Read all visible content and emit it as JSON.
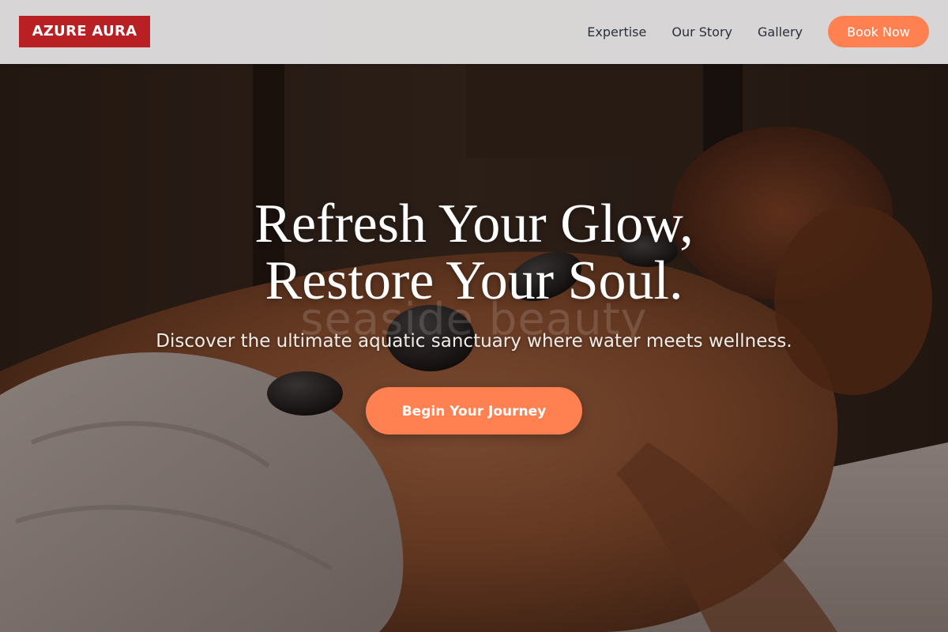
{
  "header": {
    "logo_text": "AZURE AURA",
    "nav_items": [
      "Expertise",
      "Our Story",
      "Gallery"
    ],
    "cta_label": "Book Now"
  },
  "hero": {
    "title_line_1": "Refresh Your Glow,",
    "title_line_2": "Restore Your Soul.",
    "watermark": "seaside beauty",
    "subtitle": "Discover the ultimate aquatic sanctuary where water meets wellness.",
    "cta_label": "Begin Your Journey",
    "background_image": "spa hot-stone massage photo"
  },
  "colors": {
    "brand_red": "#b82024",
    "accent_orange": "#ff8050",
    "header_bg": "#dddcdc",
    "nav_text": "#2b2f3a"
  }
}
